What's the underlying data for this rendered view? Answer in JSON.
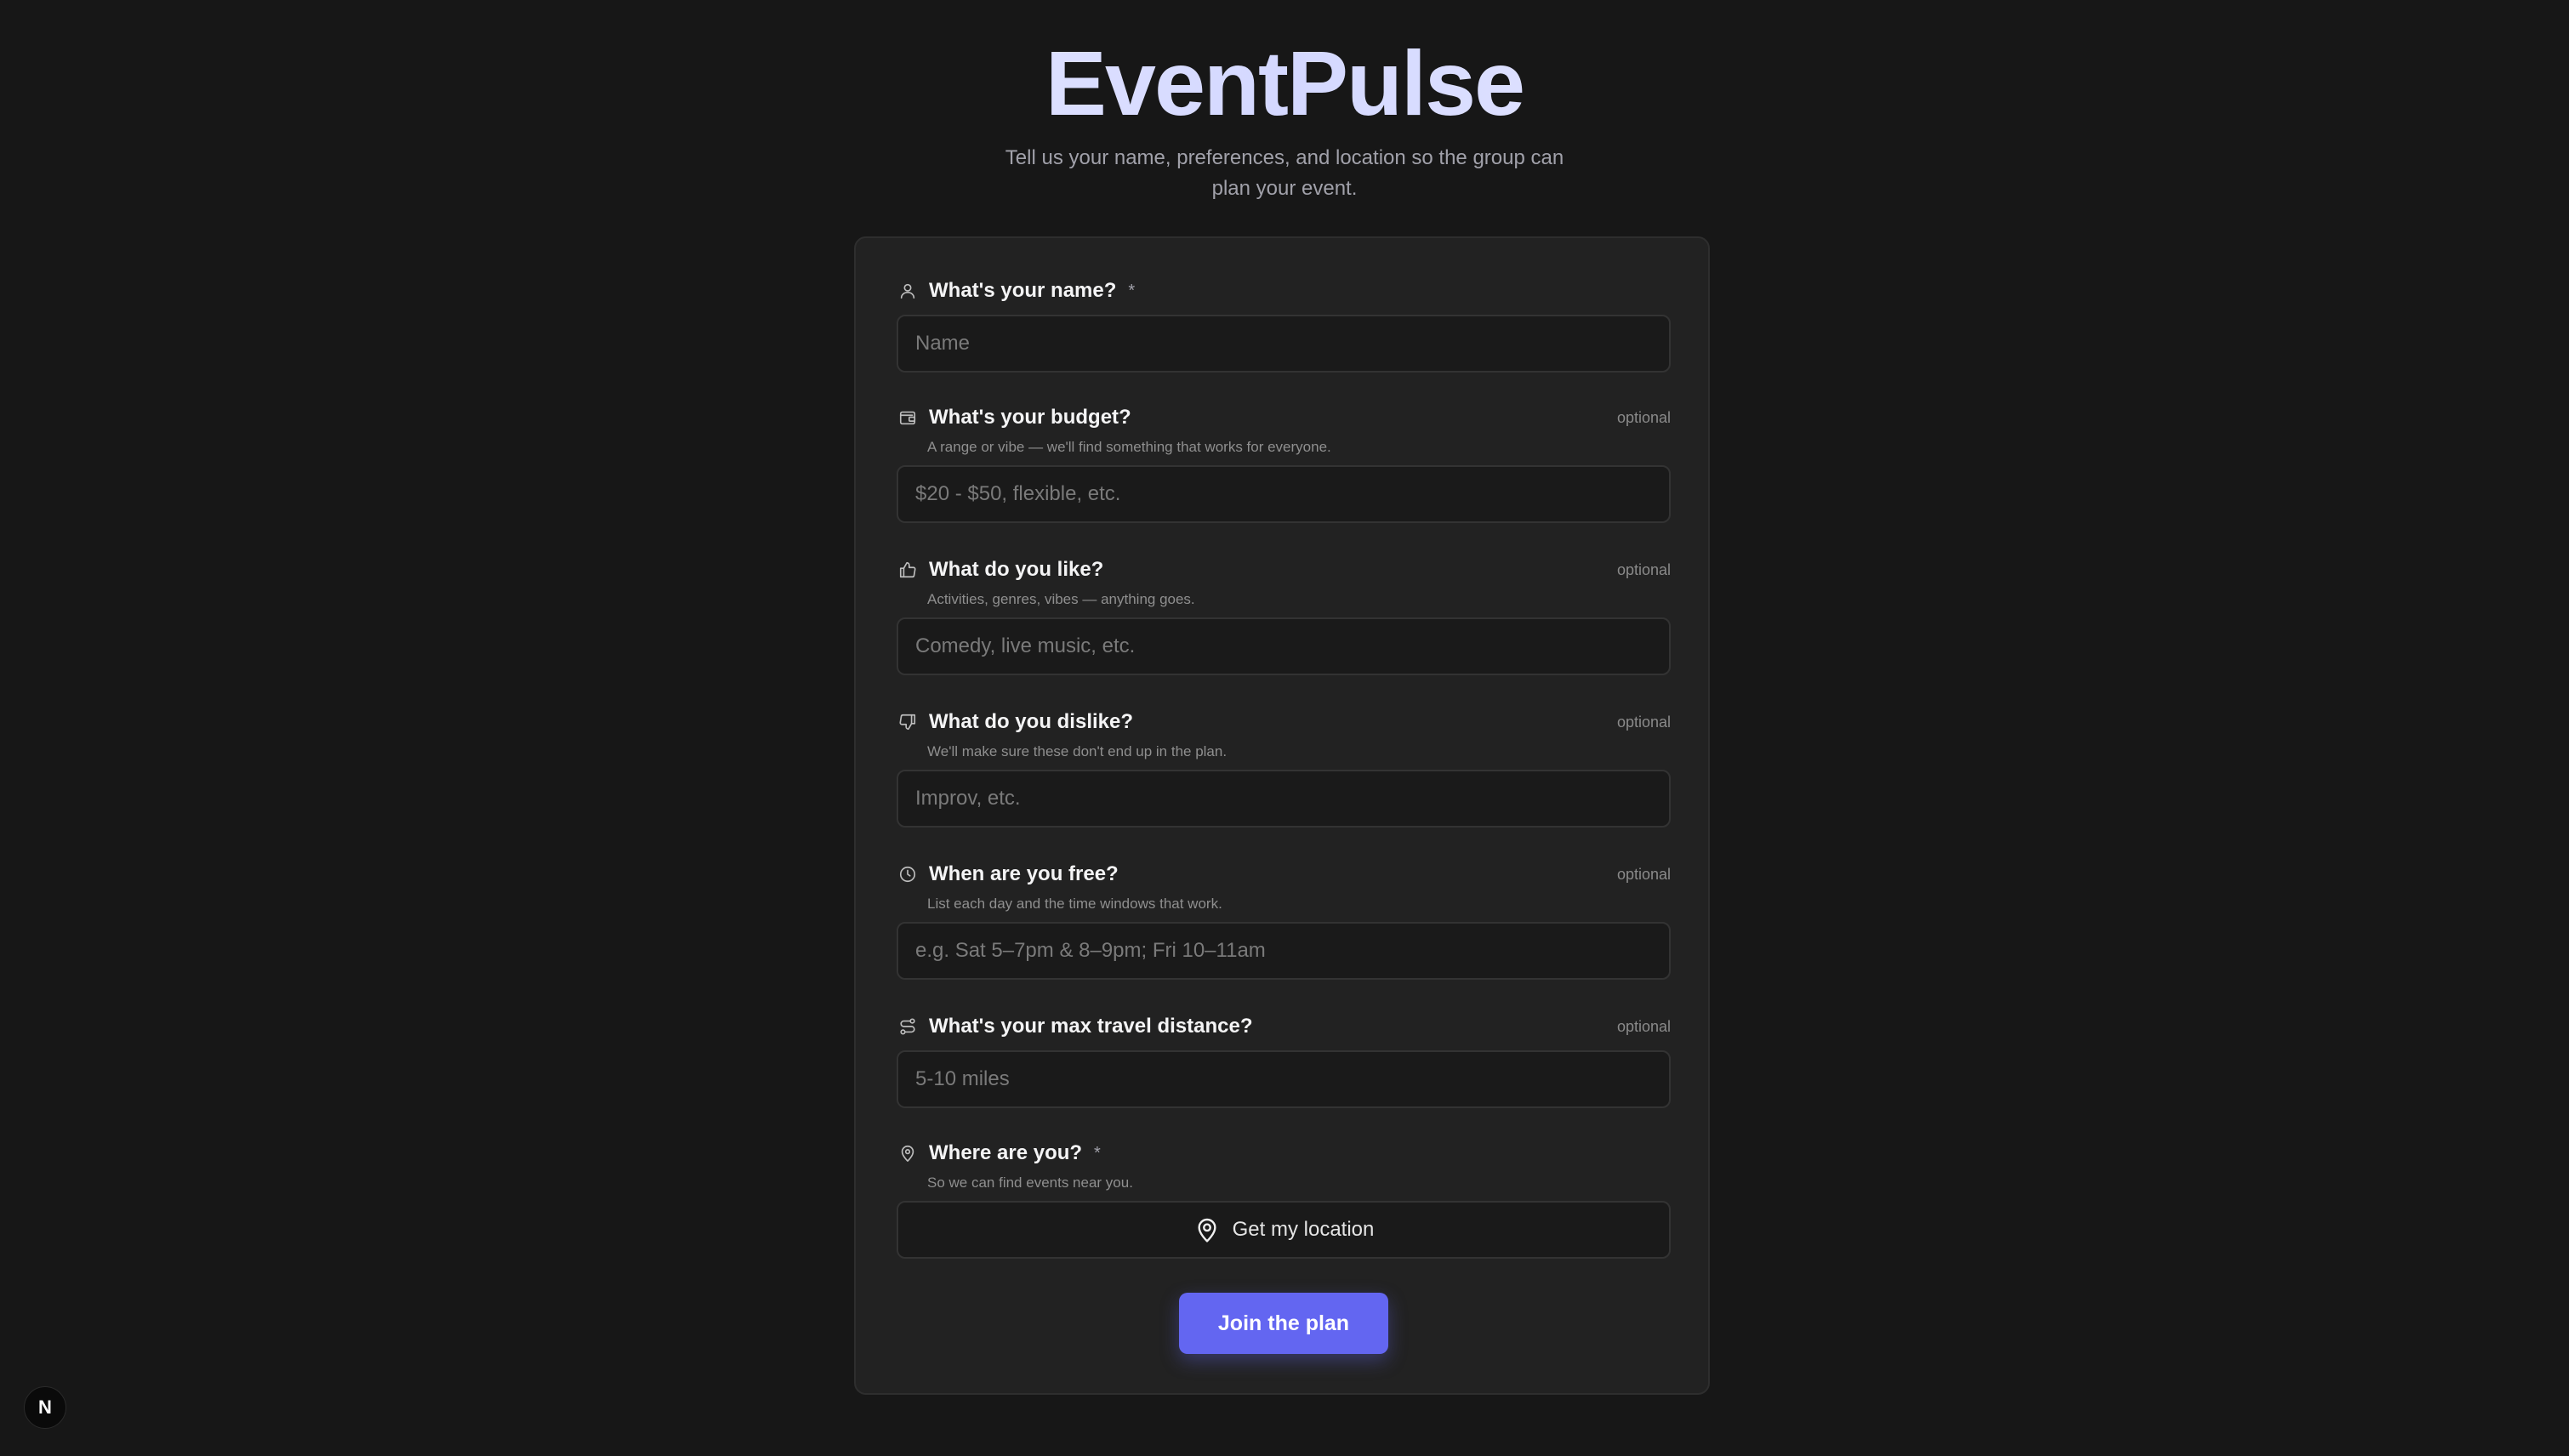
{
  "header": {
    "title": "EventPulse",
    "subtitle": "Tell us your name, preferences, and location so the group can plan your event."
  },
  "form": {
    "name": {
      "icon": "user-icon",
      "label": "What's your name?",
      "required_mark": "*",
      "placeholder": "Name",
      "value": ""
    },
    "budget": {
      "icon": "wallet-icon",
      "label": "What's your budget?",
      "optional": "optional",
      "helper": "A range or vibe — we'll find something that works for everyone.",
      "placeholder": "$20 - $50, flexible, etc.",
      "value": ""
    },
    "likes": {
      "icon": "thumbs-up-icon",
      "label": "What do you like?",
      "optional": "optional",
      "helper": "Activities, genres, vibes — anything goes.",
      "placeholder": "Comedy, live music, etc.",
      "value": ""
    },
    "dislikes": {
      "icon": "thumbs-down-icon",
      "label": "What do you dislike?",
      "optional": "optional",
      "helper": "We'll make sure these don't end up in the plan.",
      "placeholder": "Improv, etc.",
      "value": ""
    },
    "availability": {
      "icon": "clock-icon",
      "label": "When are you free?",
      "optional": "optional",
      "helper": "List each day and the time windows that work.",
      "placeholder": "e.g. Sat 5–7pm & 8–9pm; Fri 10–11am",
      "value": ""
    },
    "distance": {
      "icon": "route-icon",
      "label": "What's your max travel distance?",
      "optional": "optional",
      "placeholder": "5-10 miles",
      "value": ""
    },
    "location": {
      "icon": "map-pin-icon",
      "label": "Where are you?",
      "required_mark": "*",
      "helper": "So we can find events near you.",
      "button_label": "Get my location"
    },
    "submit_label": "Join the plan"
  },
  "badge": {
    "label": "N"
  },
  "colors": {
    "background": "#171717",
    "card": "#222222",
    "accent": "#6366f1"
  }
}
